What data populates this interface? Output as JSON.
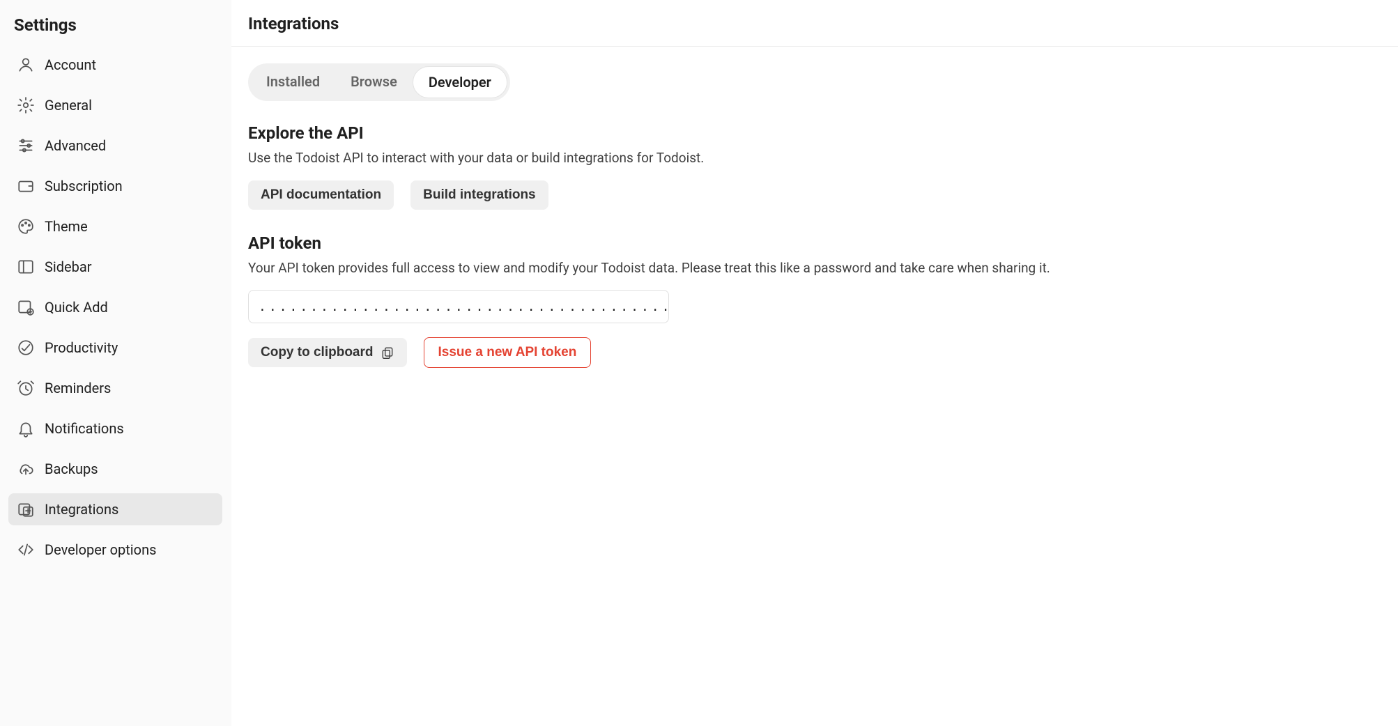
{
  "sidebar": {
    "title": "Settings",
    "items": [
      {
        "label": "Account",
        "icon": "user"
      },
      {
        "label": "General",
        "icon": "gear"
      },
      {
        "label": "Advanced",
        "icon": "sliders"
      },
      {
        "label": "Subscription",
        "icon": "wallet"
      },
      {
        "label": "Theme",
        "icon": "palette"
      },
      {
        "label": "Sidebar",
        "icon": "sidebar"
      },
      {
        "label": "Quick Add",
        "icon": "quickadd"
      },
      {
        "label": "Productivity",
        "icon": "productivity"
      },
      {
        "label": "Reminders",
        "icon": "alarm"
      },
      {
        "label": "Notifications",
        "icon": "bell"
      },
      {
        "label": "Backups",
        "icon": "cloud"
      },
      {
        "label": "Integrations",
        "icon": "integrations",
        "active": true
      },
      {
        "label": "Developer options",
        "icon": "code"
      }
    ]
  },
  "header": {
    "title": "Integrations"
  },
  "tabs": [
    {
      "label": "Installed"
    },
    {
      "label": "Browse"
    },
    {
      "label": "Developer",
      "active": true
    }
  ],
  "sections": {
    "explore": {
      "heading": "Explore the API",
      "desc": "Use the Todoist API to interact with your data or build integrations for Todoist.",
      "buttons": {
        "docs": "API documentation",
        "build": "Build integrations"
      }
    },
    "token": {
      "heading": "API token",
      "desc": "Your API token provides full access to view and modify your Todoist data. Please treat this like a password and take care when sharing it.",
      "masked_value": "........................................",
      "copy_label": "Copy to clipboard",
      "issue_label": "Issue a new API token"
    }
  }
}
